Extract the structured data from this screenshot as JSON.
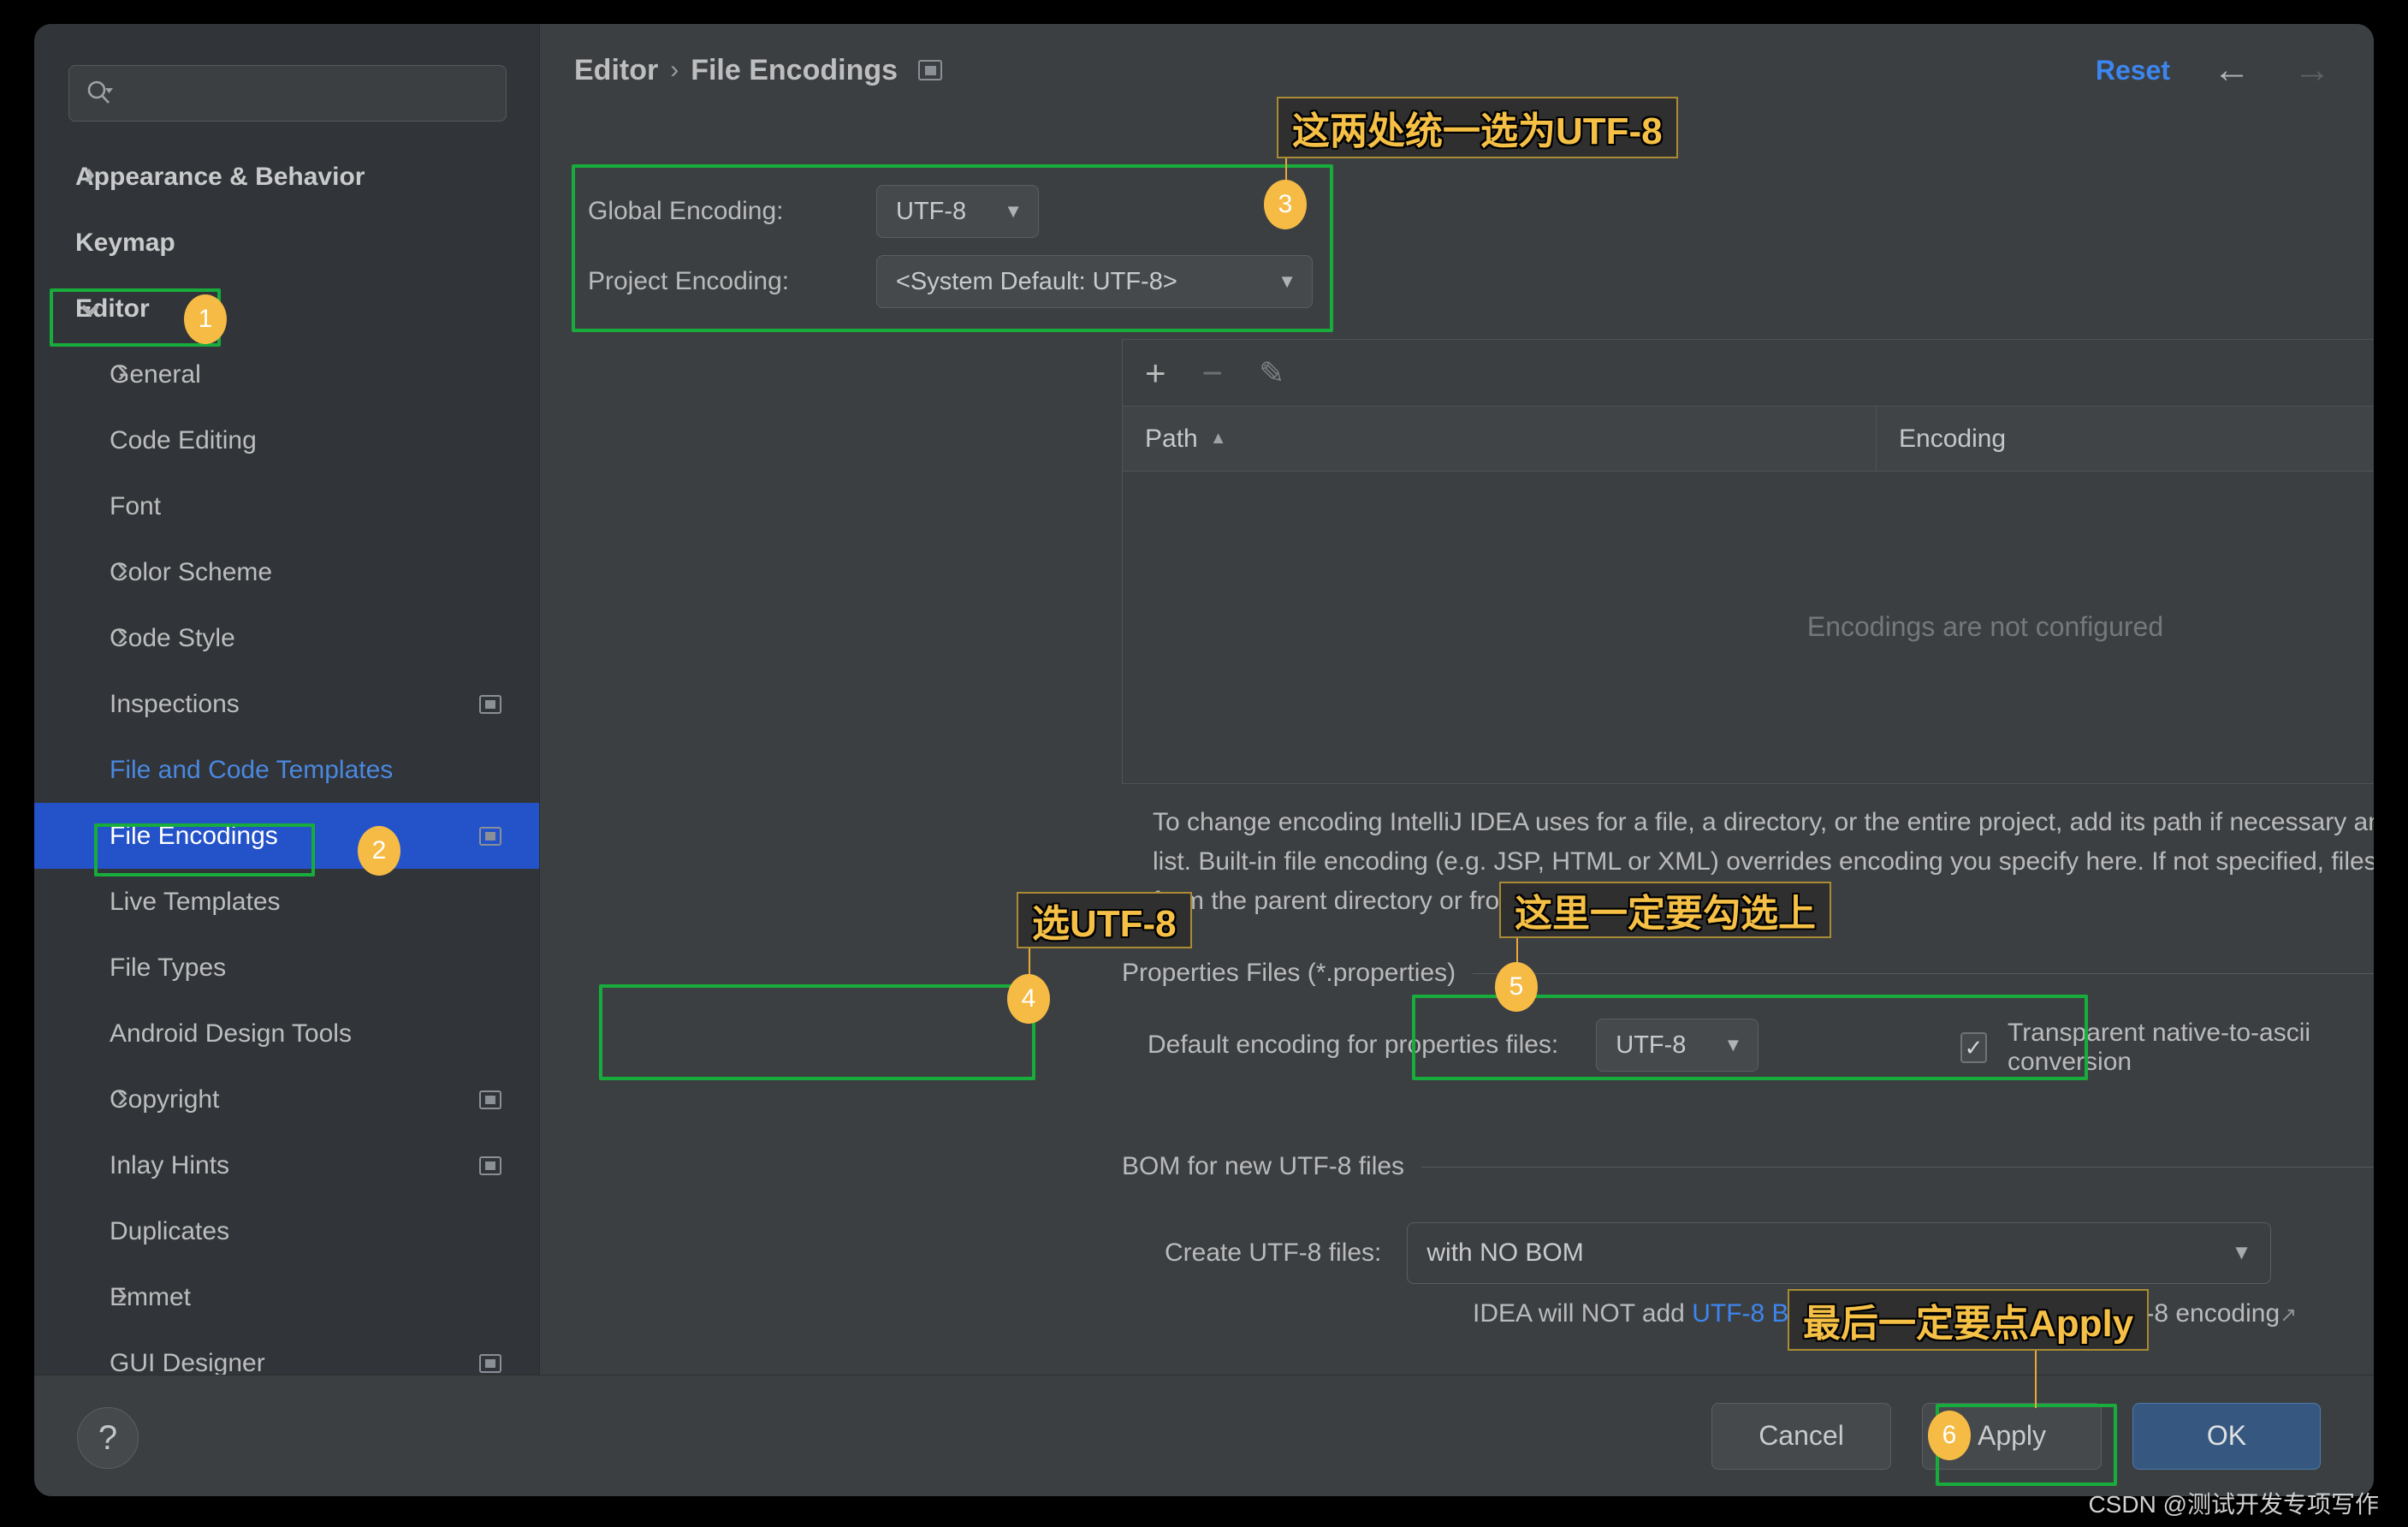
{
  "sidebar": {
    "search": {
      "placeholder": "",
      "value": "",
      "icon": "search-icon"
    },
    "items": [
      {
        "label": "Appearance & Behavior",
        "level": 0,
        "chevron": "right",
        "bold": true,
        "selected": false,
        "link": false,
        "trailing": false
      },
      {
        "label": "Keymap",
        "level": 0,
        "chevron": "",
        "bold": true,
        "selected": false,
        "link": false,
        "trailing": false
      },
      {
        "label": "Editor",
        "level": 0,
        "chevron": "down",
        "bold": true,
        "selected": false,
        "link": false,
        "trailing": false
      },
      {
        "label": "General",
        "level": 1,
        "chevron": "right",
        "bold": false,
        "selected": false,
        "link": false,
        "trailing": false
      },
      {
        "label": "Code Editing",
        "level": 1,
        "chevron": "",
        "bold": false,
        "selected": false,
        "link": false,
        "trailing": false
      },
      {
        "label": "Font",
        "level": 1,
        "chevron": "",
        "bold": false,
        "selected": false,
        "link": false,
        "trailing": false
      },
      {
        "label": "Color Scheme",
        "level": 1,
        "chevron": "right",
        "bold": false,
        "selected": false,
        "link": false,
        "trailing": false
      },
      {
        "label": "Code Style",
        "level": 1,
        "chevron": "right",
        "bold": false,
        "selected": false,
        "link": false,
        "trailing": false
      },
      {
        "label": "Inspections",
        "level": 1,
        "chevron": "",
        "bold": false,
        "selected": false,
        "link": false,
        "trailing": true
      },
      {
        "label": "File and Code Templates",
        "level": 1,
        "chevron": "",
        "bold": false,
        "selected": false,
        "link": true,
        "trailing": false
      },
      {
        "label": "File Encodings",
        "level": 1,
        "chevron": "",
        "bold": false,
        "selected": true,
        "link": false,
        "trailing": true
      },
      {
        "label": "Live Templates",
        "level": 1,
        "chevron": "",
        "bold": false,
        "selected": false,
        "link": false,
        "trailing": false
      },
      {
        "label": "File Types",
        "level": 1,
        "chevron": "",
        "bold": false,
        "selected": false,
        "link": false,
        "trailing": false
      },
      {
        "label": "Android Design Tools",
        "level": 1,
        "chevron": "",
        "bold": false,
        "selected": false,
        "link": false,
        "trailing": false
      },
      {
        "label": "Copyright",
        "level": 1,
        "chevron": "right",
        "bold": false,
        "selected": false,
        "link": false,
        "trailing": true
      },
      {
        "label": "Inlay Hints",
        "level": 1,
        "chevron": "",
        "bold": false,
        "selected": false,
        "link": false,
        "trailing": true
      },
      {
        "label": "Duplicates",
        "level": 1,
        "chevron": "",
        "bold": false,
        "selected": false,
        "link": false,
        "trailing": false
      },
      {
        "label": "Emmet",
        "level": 1,
        "chevron": "right",
        "bold": false,
        "selected": false,
        "link": false,
        "trailing": false
      },
      {
        "label": "GUI Designer",
        "level": 1,
        "chevron": "",
        "bold": false,
        "selected": false,
        "link": false,
        "trailing": true
      }
    ]
  },
  "header": {
    "breadcrumb_parent": "Editor",
    "breadcrumb_sep": "›",
    "breadcrumb_current": "File Encodings",
    "reset_label": "Reset",
    "back_arrow": "←",
    "forward_arrow": "→"
  },
  "encoding": {
    "global_label": "Global Encoding:",
    "global_value": "UTF-8",
    "project_label": "Project Encoding:",
    "project_value": "<System Default: UTF-8>",
    "caret": "▼"
  },
  "table": {
    "toolbar": {
      "add": "+",
      "remove": "−",
      "edit": "✎"
    },
    "columns": [
      "Path",
      "Encoding"
    ],
    "sort_caret": "▲",
    "rows": [],
    "empty_text": "Encodings are not configured"
  },
  "description": "To change encoding IntelliJ IDEA uses for a file, a directory, or the entire project, add its path if necessary and then select encoding from the encoding list. Built-in file encoding (e.g. JSP, HTML or XML) overrides encoding you specify here. If not specified, files and directories inherit encoding settings from the parent directory or from the Project Encoding.",
  "properties_section": {
    "title": "Properties Files (*.properties)",
    "default_encoding_label": "Default encoding for properties files:",
    "default_encoding_value": "UTF-8",
    "caret": "▼",
    "transparent_label": "Transparent native-to-ascii conversion",
    "transparent_checked": true,
    "check_glyph": "✓"
  },
  "bom_section": {
    "title": "BOM for new UTF-8 files",
    "create_label": "Create UTF-8 files:",
    "create_value": "with NO BOM",
    "caret": "▼",
    "note_prefix": "IDEA will NOT add ",
    "note_link": "UTF-8 BOM",
    "note_suffix": " to every created file in UTF-8 encoding",
    "note_ext_icon": "↗"
  },
  "footer": {
    "help_label": "?",
    "cancel_label": "Cancel",
    "apply_label": "Apply",
    "ok_label": "OK"
  },
  "annotations": {
    "note_top": "这两处统一选为UTF-8",
    "note_props": "选UTF-8",
    "note_check": "这里一定要勾选上",
    "note_apply": "最后一定要点Apply",
    "badge1": "1",
    "badge2": "2",
    "badge3": "3",
    "badge4": "4",
    "badge5": "5",
    "badge6": "6",
    "highlight_color": "#18ac3c",
    "badge_color": "#f5bb45",
    "note_color": "#f5c045"
  },
  "watermark": "CSDN @测试开发专项写作"
}
